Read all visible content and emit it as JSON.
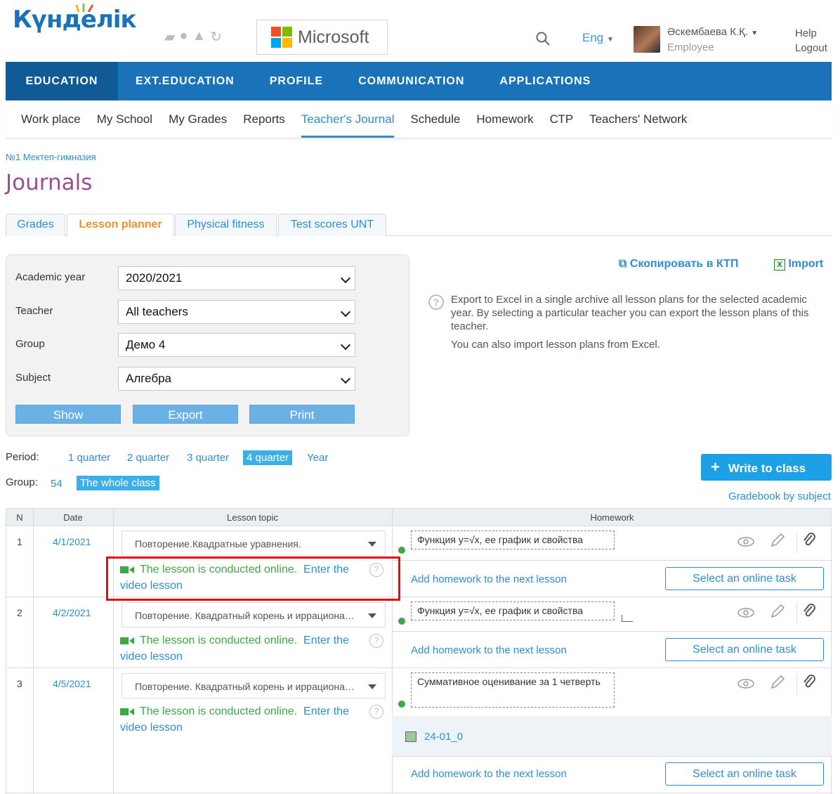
{
  "header": {
    "logo_text": "Күнделік",
    "microsoft_label": "Microsoft",
    "language": "Eng",
    "user_name": "Әскембаева К.Қ.",
    "user_role": "Employee",
    "help": "Help",
    "logout": "Logout"
  },
  "topnav": [
    "EDUCATION",
    "EXT.EDUCATION",
    "PROFILE",
    "COMMUNICATION",
    "APPLICATIONS"
  ],
  "subnav": [
    "Work place",
    "My School",
    "My Grades",
    "Reports",
    "Teacher's Journal",
    "Schedule",
    "Homework",
    "СТР",
    "Teachers' Network"
  ],
  "school": "№1 Мектеп-гимназия",
  "page_title": "Journals",
  "tabs": [
    "Grades",
    "Lesson planner",
    "Physical fitness",
    "Test scores UNT"
  ],
  "filter": {
    "academic_year_label": "Academic year",
    "academic_year": "2020/2021",
    "teacher_label": "Teacher",
    "teacher": "All teachers",
    "group_label": "Group",
    "group": "Демо 4",
    "subject_label": "Subject",
    "subject": "Алгебра",
    "show": "Show",
    "export": "Export",
    "print": "Print"
  },
  "actions": {
    "copy_ktp": "Скопировать в КТП",
    "import": "Import"
  },
  "info": {
    "export_text": "Export to Excel in a single archive all lesson plans for the selected academic year. By selecting a particular teacher you can export the lesson plans of this teacher.",
    "import_text": "You can also import lesson plans from Excel."
  },
  "period": {
    "label": "Period:",
    "items": [
      "1 quarter",
      "2 quarter",
      "3 quarter",
      "4 quarter",
      "Year"
    ],
    "active": "4 quarter"
  },
  "group_filter": {
    "label": "Group:",
    "number": "54",
    "whole": "The whole class"
  },
  "write_to_class": "Write to class",
  "gradebook_by_subject": "Gradebook by subject",
  "table": {
    "headers": [
      "N",
      "Date",
      "Lesson topic",
      "Homework"
    ],
    "online_text": "The lesson is conducted online.",
    "enter_text": "Enter the",
    "video_lesson": "video lesson",
    "add_hw": "Add homework to the next lesson",
    "select_task": "Select an online task",
    "rows": [
      {
        "n": "1",
        "date": "4/1/2021",
        "topic": "Повторение.Квадратные уравнения.",
        "homework": "Функция y=√x, ее график и свойства"
      },
      {
        "n": "2",
        "date": "4/2/2021",
        "topic": "Повторение. Квадратный корень и иррациона…",
        "homework": "Функция y=√x, ее график и свойства"
      },
      {
        "n": "3",
        "date": "4/5/2021",
        "topic": "Повторение. Квадратный корень и иррациона…",
        "homework": "Суммативное оценивание за 1 четверть",
        "file": "24-01_0"
      }
    ]
  },
  "colors": {
    "brand_blue": "#1a73b8",
    "link_blue": "#2e8fd0",
    "title_purple": "#9c4e8e",
    "online_green": "#3aa946",
    "highlight_red": "#e01010"
  }
}
